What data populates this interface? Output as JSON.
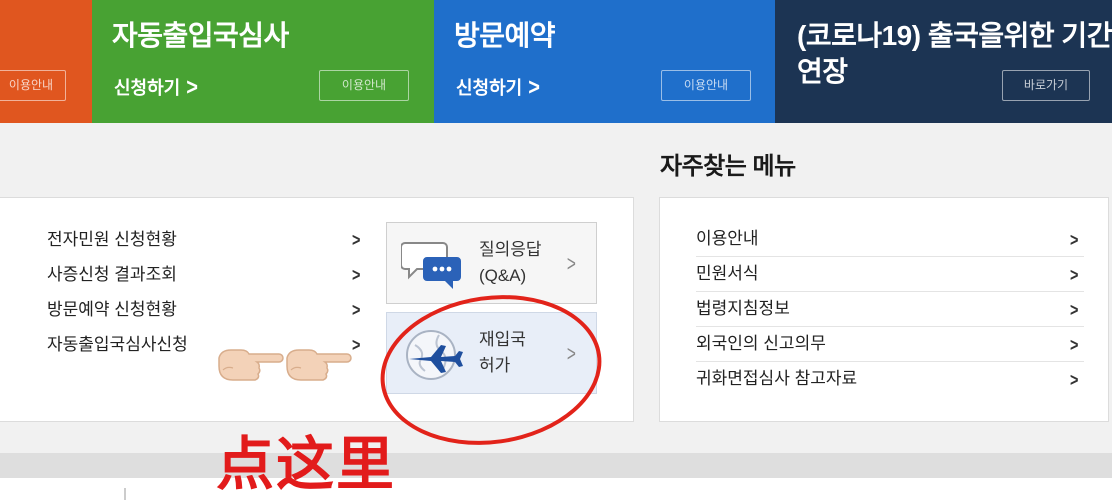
{
  "banners": {
    "orange": {
      "button": "이용안내"
    },
    "green": {
      "title": "자동출입국심사",
      "apply": "신청하기",
      "arrow": ">",
      "button": "이용안내"
    },
    "blue": {
      "title": "방문예약",
      "apply": "신청하기",
      "arrow": ">",
      "button": "이용안내"
    },
    "navy": {
      "title": "(코로나19) 출국을위한 기간연장",
      "button": "바로가기"
    }
  },
  "frequent_menu": {
    "title": "자주찾는 메뉴"
  },
  "left_links": [
    {
      "label": "전자민원 신청현황",
      "chevron": ">"
    },
    {
      "label": "사증신청 결과조회",
      "chevron": ">"
    },
    {
      "label": "방문예약 신청현황",
      "chevron": ">"
    },
    {
      "label": "자동출입국심사신청",
      "chevron": ">"
    }
  ],
  "qna": {
    "line1": "질의응답",
    "line2": "(Q&A)",
    "chevron": ">",
    "icon": "chat-bubbles-icon"
  },
  "reentry": {
    "line1": "재입국",
    "line2": "허가",
    "chevron": ">",
    "icon": "airplane-globe-icon"
  },
  "right_links": [
    {
      "label": "이용안내",
      "chevron": ">"
    },
    {
      "label": "민원서식",
      "chevron": ">"
    },
    {
      "label": "법령지침정보",
      "chevron": ">"
    },
    {
      "label": "외국인의 신고의무",
      "chevron": ">"
    },
    {
      "label": "귀화면접심사 참고자료",
      "chevron": ">"
    }
  ],
  "annotation": {
    "text": "点这里",
    "color": "#e21b1b"
  },
  "colors": {
    "orange": "#e0561f",
    "green": "#48a233",
    "blue": "#1f6fcb",
    "navy": "#1c3453"
  }
}
